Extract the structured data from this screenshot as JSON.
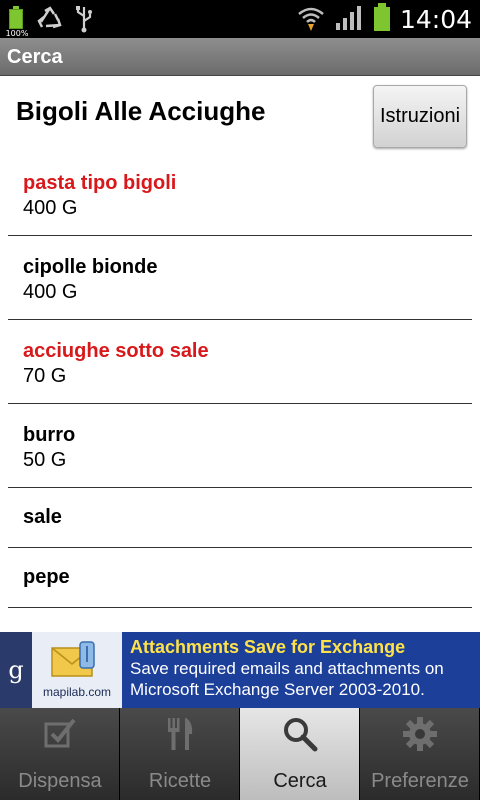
{
  "status_bar": {
    "time": "14:04",
    "battery_small_label": "100%",
    "icons": [
      "battery-charging-icon",
      "recycle-icon",
      "usb-icon",
      "wifi-icon",
      "signal-icon",
      "battery-icon"
    ]
  },
  "action_bar": {
    "title": "Cerca"
  },
  "recipe": {
    "title": "Bigoli Alle Acciughe",
    "instructions_button": "Istruzioni"
  },
  "ingredients": [
    {
      "name": "pasta tipo bigoli",
      "quantity": "400 G",
      "highlighted": true
    },
    {
      "name": "cipolle bionde",
      "quantity": "400 G",
      "highlighted": false
    },
    {
      "name": "acciughe sotto sale",
      "quantity": "70 G",
      "highlighted": true
    },
    {
      "name": "burro",
      "quantity": "50 G",
      "highlighted": false
    },
    {
      "name": "sale",
      "quantity": "",
      "highlighted": false
    },
    {
      "name": "pepe",
      "quantity": "",
      "highlighted": false
    }
  ],
  "ad": {
    "g_label": "g",
    "brand": "mapilab.com",
    "headline": "Attachments Save for Exchange",
    "line1": "Save required emails and attachments on",
    "line2": "Microsoft Exchange Server 2003-2010."
  },
  "tabs": [
    {
      "label": "Dispensa",
      "icon": "checkbox-icon",
      "active": false
    },
    {
      "label": "Ricette",
      "icon": "fork-knife-icon",
      "active": false
    },
    {
      "label": "Cerca",
      "icon": "search-icon",
      "active": true
    },
    {
      "label": "Preferenze",
      "icon": "gear-icon",
      "active": false
    }
  ],
  "colors": {
    "highlight_text": "#d8181b",
    "ad_background": "#1c3f9a",
    "ad_headline": "#ffe24a",
    "battery_green": "#7ec630"
  }
}
